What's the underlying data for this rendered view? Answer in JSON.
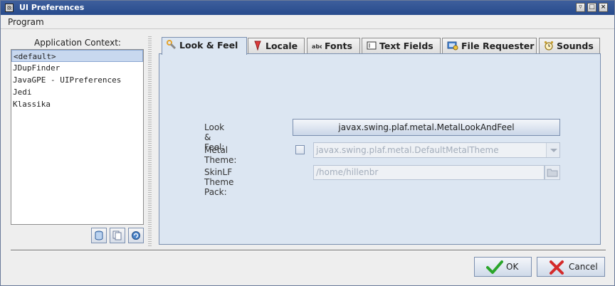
{
  "window": {
    "title": "UI Preferences"
  },
  "menu": {
    "program": "Program"
  },
  "context": {
    "label": "Application Context:",
    "items": [
      "<default>",
      "JDupFinder",
      "JavaGPE - UIPreferences",
      "Jedi",
      "Klassika"
    ],
    "selected_index": 0
  },
  "tabs": [
    {
      "label": "Look & Feel",
      "icon": "wrench-icon",
      "active": true
    },
    {
      "label": "Locale",
      "icon": "pin-icon",
      "active": false
    },
    {
      "label": "Fonts",
      "icon": "abc-icon",
      "active": false
    },
    {
      "label": "Text Fields",
      "icon": "text-field-icon",
      "active": false
    },
    {
      "label": "File Requester",
      "icon": "file-requester-icon",
      "active": false
    },
    {
      "label": "Sounds",
      "icon": "alarm-clock-icon",
      "active": false
    }
  ],
  "look_and_feel": {
    "lf_label": "Look & Feel:",
    "lf_value": "javax.swing.plaf.metal.MetalLookAndFeel",
    "theme_label": "Metal Theme:",
    "theme_checked": false,
    "theme_value": "javax.swing.plaf.metal.DefaultMetalTheme",
    "skin_label": "SkinLF Theme Pack:",
    "skin_value": "/home/hillenbr"
  },
  "buttons": {
    "ok": "OK",
    "cancel": "Cancel"
  },
  "colors": {
    "accent": "#274b8c",
    "panel": "#dce6f2",
    "selection": "#c8d8ef",
    "ok_check": "#2aa52a",
    "cancel_x": "#d42a2a"
  }
}
